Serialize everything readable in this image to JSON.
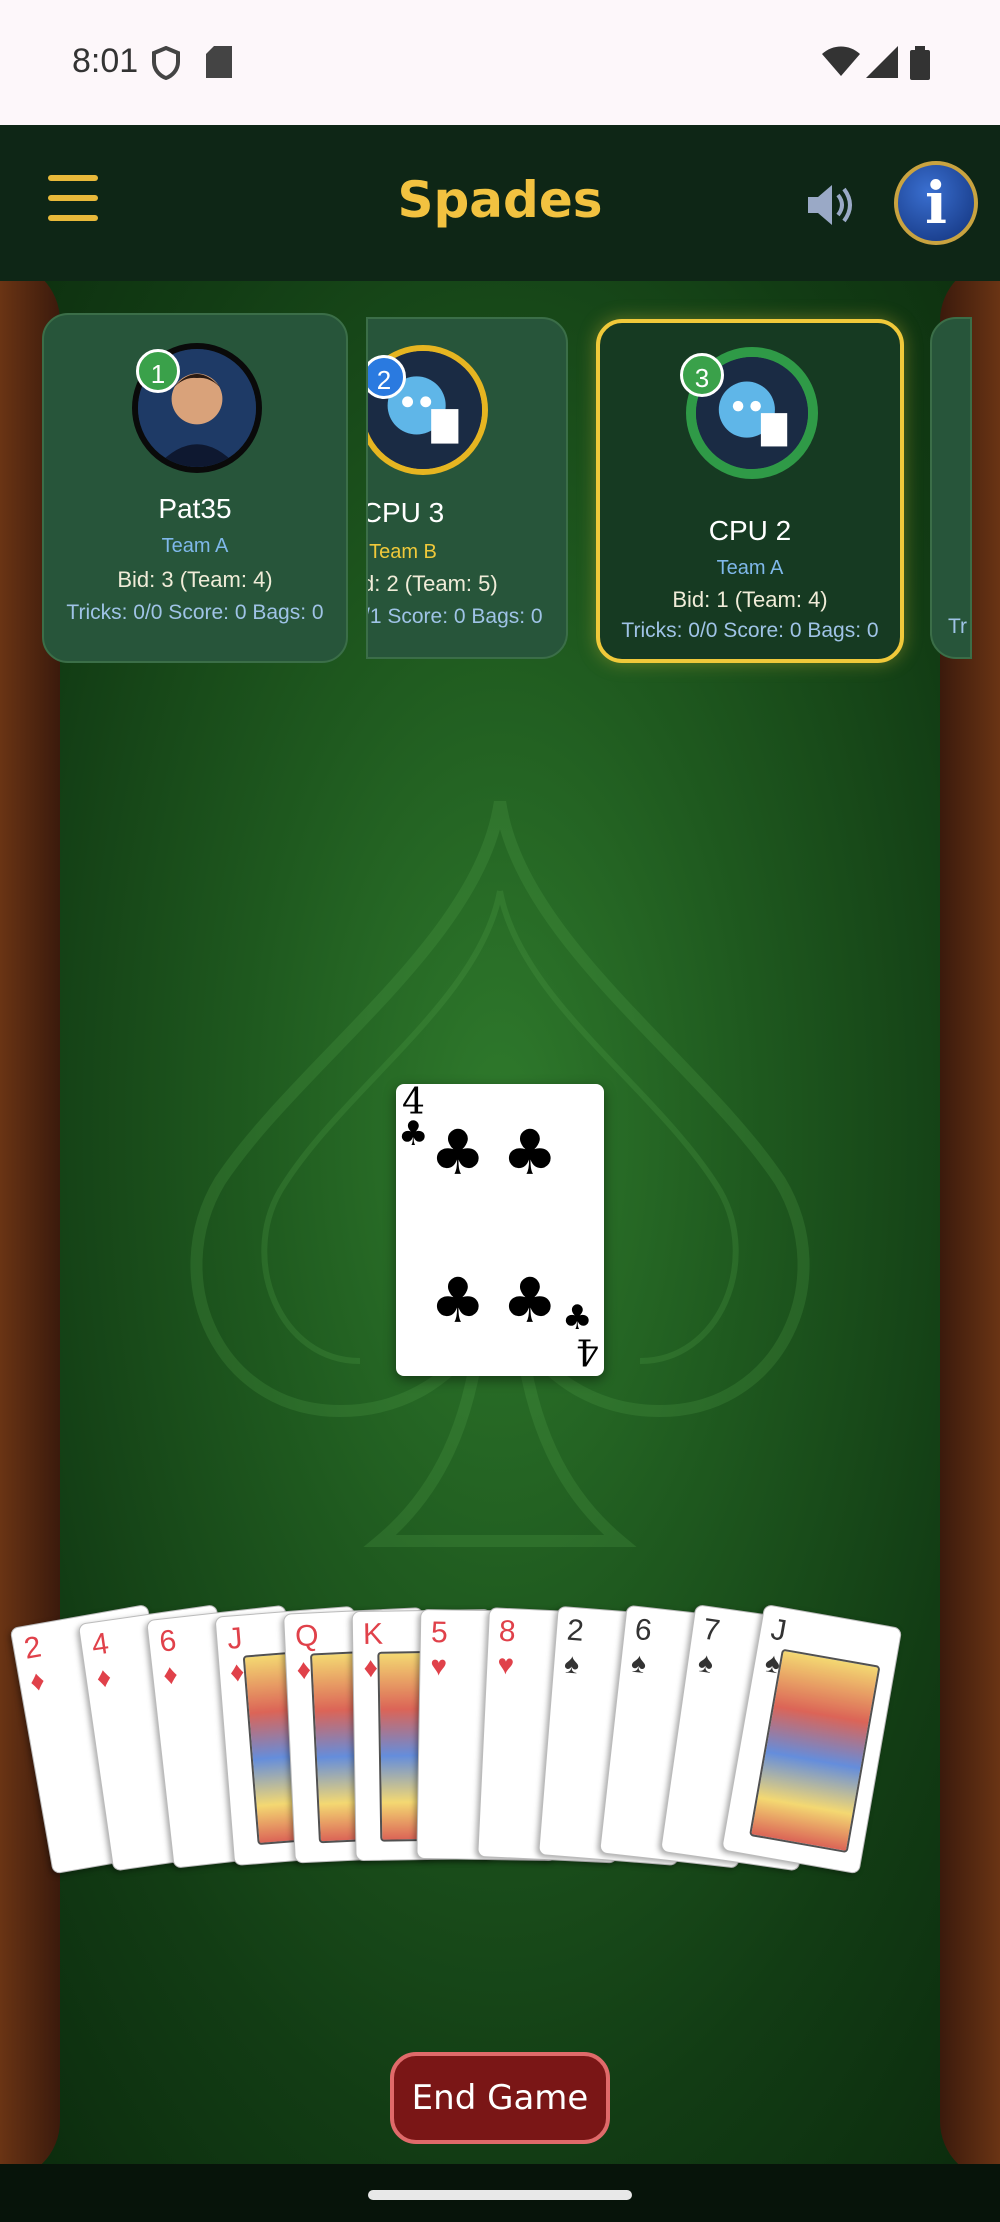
{
  "status_bar": {
    "time": "8:01"
  },
  "header": {
    "title": "Spades"
  },
  "players": [
    {
      "seat": "1",
      "name": "Pat35",
      "team": "Team A",
      "bid": "Bid: 3  (Team: 4)",
      "stats": "Tricks: 0/0  Score: 0  Bags: 0"
    },
    {
      "seat": "2",
      "name": "CPU 3",
      "team": "Team B",
      "bid": "d: 2  (Team: 5)",
      "stats": "/1  Score: 0  Bags: 0"
    },
    {
      "seat": "3",
      "name": "CPU 2",
      "team": "Team A",
      "bid": "Bid: 1  (Team: 4)",
      "stats": "Tricks: 0/0  Score: 0  Bags: 0"
    },
    {
      "stats": "Tr"
    }
  ],
  "center_card": {
    "rank": "4",
    "suit": "♣"
  },
  "hand": [
    {
      "rank": "2",
      "suit": "♦",
      "color": "#e0414a"
    },
    {
      "rank": "4",
      "suit": "♦",
      "color": "#e0414a"
    },
    {
      "rank": "6",
      "suit": "♦",
      "color": "#e0414a"
    },
    {
      "rank": "J",
      "suit": "♦",
      "color": "#e0414a"
    },
    {
      "rank": "Q",
      "suit": "♦",
      "color": "#e0414a"
    },
    {
      "rank": "K",
      "suit": "♦",
      "color": "#e0414a"
    },
    {
      "rank": "5",
      "suit": "♥",
      "color": "#e0414a"
    },
    {
      "rank": "8",
      "suit": "♥",
      "color": "#e0414a"
    },
    {
      "rank": "2",
      "suit": "♠",
      "color": "#333333"
    },
    {
      "rank": "6",
      "suit": "♠",
      "color": "#333333"
    },
    {
      "rank": "7",
      "suit": "♠",
      "color": "#333333"
    },
    {
      "rank": "J",
      "suit": "♠",
      "color": "#333333"
    }
  ],
  "end_game_label": "End Game",
  "colors": {
    "accent": "#f2c240",
    "table_green": "#1f5a1f",
    "active_border": "#f0c93a",
    "team_a": "#7fb8ea",
    "team_b": "#f0c93a"
  }
}
